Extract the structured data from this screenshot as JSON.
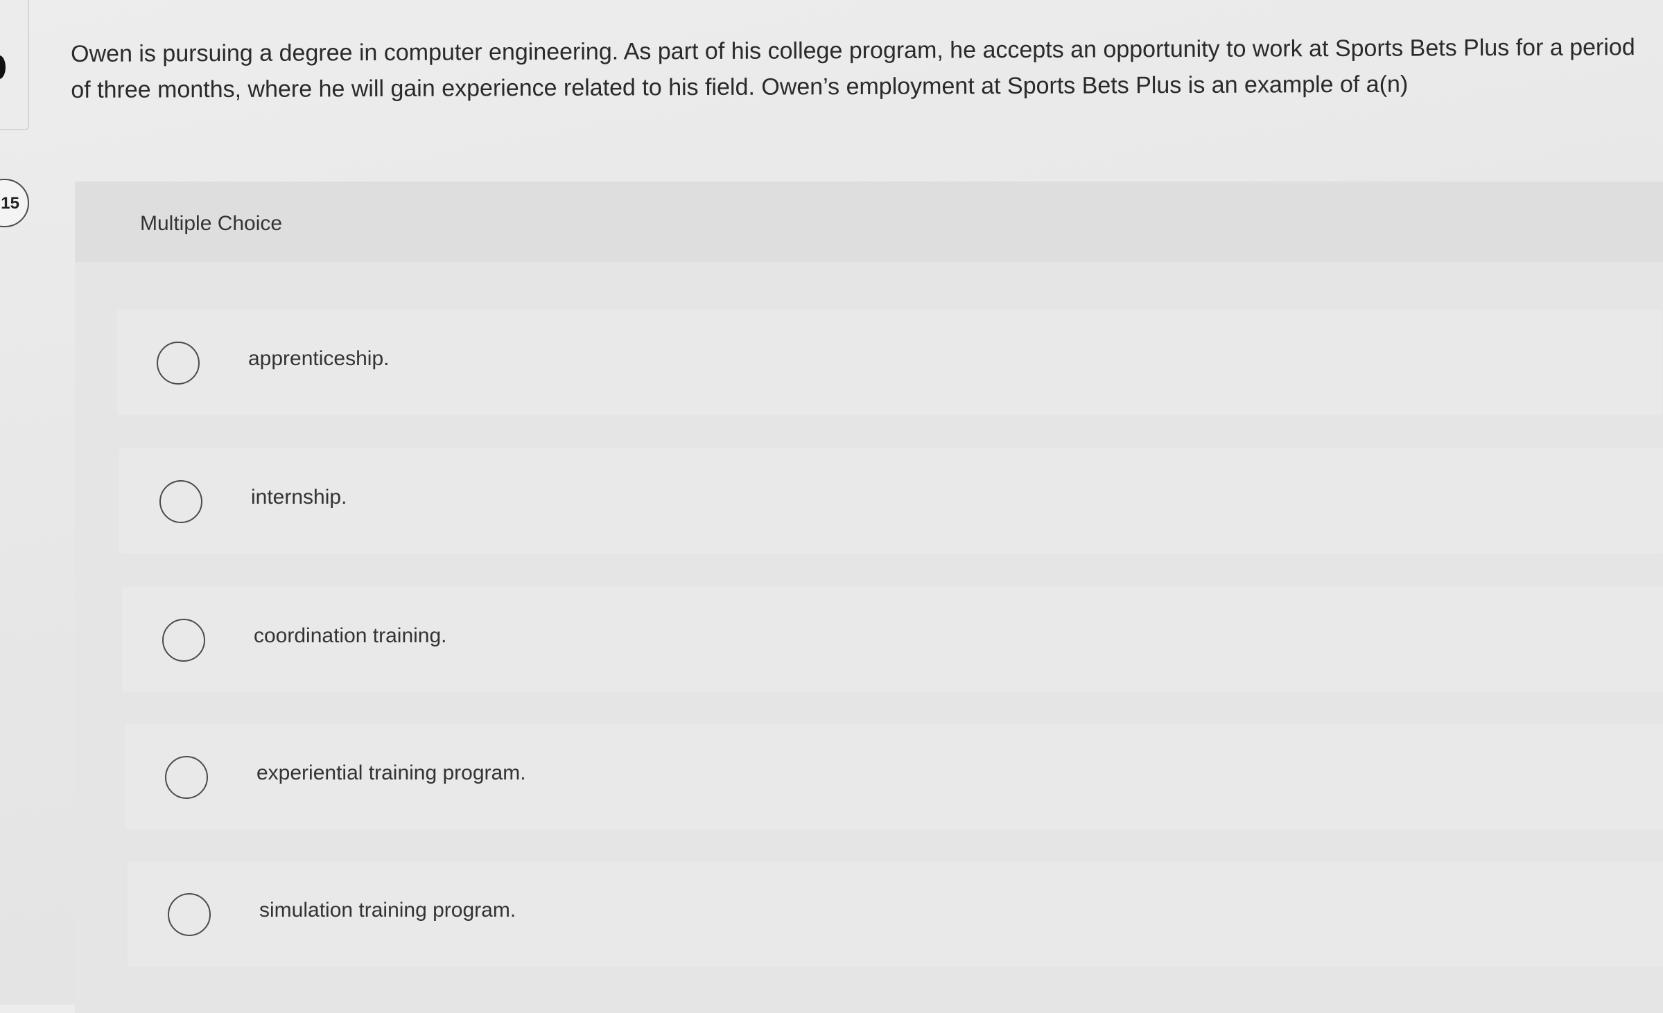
{
  "sidebar": {
    "question_badge": "15"
  },
  "question": {
    "text": "Owen is pursuing a degree in computer engineering. As part of his college program, he accepts an opportunity to work at Sports Bets Plus for a period of three months, where he will gain experience related to his field. Owen’s employment at Sports Bets Plus is an example of a(n)"
  },
  "multiple_choice": {
    "title": "Multiple Choice",
    "options": [
      {
        "label": "apprenticeship."
      },
      {
        "label": "internship."
      },
      {
        "label": "coordination training."
      },
      {
        "label": "experiential training program."
      },
      {
        "label": "simulation training program."
      }
    ]
  }
}
